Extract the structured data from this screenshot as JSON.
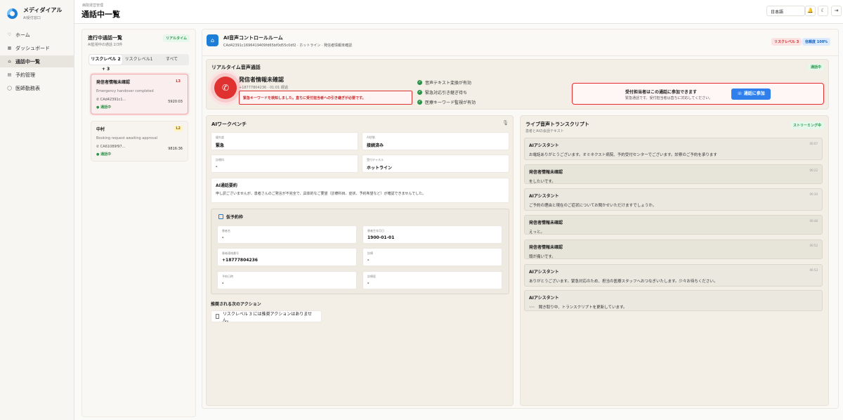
{
  "brand": {
    "title": "メディダイアル",
    "subtitle": "AI受付窓口"
  },
  "nav": [
    {
      "icon": "♡",
      "label": "ホーム"
    },
    {
      "icon": "▦",
      "label": "ダッシュボード"
    },
    {
      "icon": "⌂",
      "label": "通話中一覧"
    },
    {
      "icon": "▤",
      "label": "予約管理"
    },
    {
      "icon": "◯",
      "label": "医師勤務表"
    }
  ],
  "header": {
    "crumb": "病院運営管理",
    "title": "通話中一覧",
    "language": "日本語",
    "bell": "🔔",
    "theme": "☾",
    "logout": "⇥"
  },
  "callList": {
    "title": "進行中通話一覧",
    "subtitle": "AI監視中の通話 2/3件",
    "realtime": "リアルタイム",
    "tabs": [
      "リスクレベル 2 + 3",
      "リスクレベル1",
      "すべて"
    ],
    "calls": [
      {
        "name": "発信者情報未確認",
        "level": "L3",
        "desc": "Emergency handover completed",
        "id": "CAd42391c1...",
        "time": "5920:03",
        "status": "● 通話中"
      },
      {
        "name": "中村",
        "level": "L2",
        "desc": "Booking request awaiting approval",
        "id": "CA61089f97...",
        "time": "9816:36",
        "status": "● 通話中"
      }
    ]
  },
  "controlRoom": {
    "icon": "⌂",
    "title": "AI音声コントロールルーム",
    "subtitle": "CAd42391c1696419409fd65bf0d55c0df2 · ホットライン · 発信者情報未確認",
    "riskBadge": "リスクレベル 3",
    "confBadge": "信頼度 100%"
  },
  "realtime": {
    "title": "リアルタイム音声通話",
    "status": "通話中",
    "phoneIcon": "✆",
    "callerName": "発信者情報未確認",
    "callerNumber": "+18777804236 · 01:01 経過",
    "alert": "緊急キーワードを検知しました。直ちに受付担当者への引き継ぎが必要です。",
    "checks": [
      "音声テキスト変換が有効",
      "緊急対応引き継ぎ待ち",
      "医療キーワード監視が有効"
    ],
    "join": {
      "title": "受付担当者はこの通話に参加できます",
      "subtitle": "緊急通話です。受付担当者は直ちに対応してください。",
      "button": "通話に参加"
    }
  },
  "workbench": {
    "title": "AIワークベンチ",
    "mic": "🎙",
    "fields": [
      {
        "label": "優先度",
        "value": "緊急"
      },
      {
        "label": "AI状態",
        "value": "接続済み"
      },
      {
        "label": "診療科",
        "value": "-"
      },
      {
        "label": "受付チャネル",
        "value": "ホットライン"
      }
    ],
    "summary": {
      "title": "AI通話要約",
      "text": "申し訳ございませんが、患者さんのご発言が不完全で、具体的なご要望（診療科目、症状、予約希望など）が確認できませんでした。"
    },
    "booking": {
      "title": "仮予約枠",
      "fields": [
        {
          "label": "患者名",
          "value": "-"
        },
        {
          "label": "患者生年月日",
          "value": "1900-01-01"
        },
        {
          "label": "患者連絡番号",
          "value": "+18777804236"
        },
        {
          "label": "診療",
          "value": "-"
        },
        {
          "label": "予約日時",
          "value": "-"
        },
        {
          "label": "診療医",
          "value": "-"
        }
      ]
    },
    "actionsTitle": "推奨される次のアクション",
    "action": "リスクレベル 3 には推奨アクションはありません。"
  },
  "transcript": {
    "title": "ライブ音声トランスクリプト",
    "subtitle": "患者とAIの会話テキスト",
    "badge": "ストリーミング中",
    "messages": [
      {
        "type": "ai",
        "sender": "AIアシスタント",
        "time": "00:07",
        "text": "お電話ありがとうございます。オミネクスト病院、予約受付センターでございます。診察のご予約を承ります"
      },
      {
        "type": "caller",
        "sender": "発信者情報未確認",
        "time": "00:22",
        "text": "をしたいです。"
      },
      {
        "type": "ai",
        "sender": "AIアシスタント",
        "time": "00:30",
        "text": "ご予約の理由と現在のご症状についてお聞かせいただけますでしょうか。"
      },
      {
        "type": "caller",
        "sender": "発信者情報未確認",
        "time": "00:48",
        "text": "えっと。"
      },
      {
        "type": "caller",
        "sender": "発信者情報未確認",
        "time": "00:52",
        "text": "頭が痛いです。"
      },
      {
        "type": "ai",
        "sender": "AIアシスタント",
        "time": "00:53",
        "text": "ありがとうございます。緊急対応のため、担当の医療スタッフへおつなぎいたします。少々お待ちください。"
      },
      {
        "type": "ai",
        "sender": "AIアシスタント",
        "time": "",
        "text": "･･･　聞き取り中、トランスクリプトを更新しています。"
      }
    ]
  }
}
